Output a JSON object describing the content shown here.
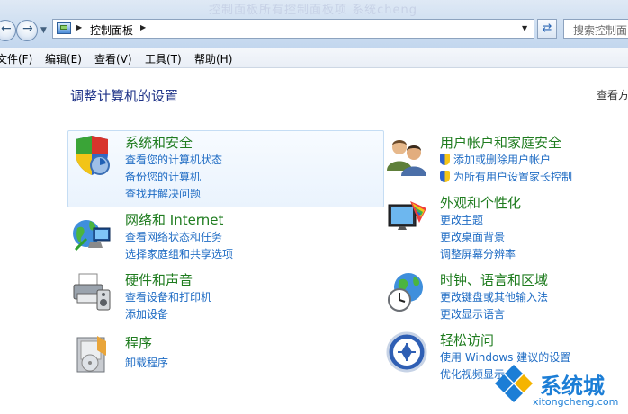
{
  "header": {
    "breadcrumb": "控制面板",
    "search_placeholder": "搜索控制面",
    "watermark": "控制面板所有控制面板项 系统cheng"
  },
  "menu": [
    "文件(F)",
    "编辑(E)",
    "查看(V)",
    "工具(T)",
    "帮助(H)"
  ],
  "main": {
    "title": "调整计算机的设置",
    "view_by": "查看方"
  },
  "categories": {
    "system_security": {
      "title": "系统和安全",
      "links": [
        "查看您的计算机状态",
        "备份您的计算机",
        "查找并解决问题"
      ]
    },
    "network": {
      "title": "网络和 Internet",
      "links": [
        "查看网络状态和任务",
        "选择家庭组和共享选项"
      ]
    },
    "hardware": {
      "title": "硬件和声音",
      "links": [
        "查看设备和打印机",
        "添加设备"
      ]
    },
    "programs": {
      "title": "程序",
      "links": [
        "卸载程序"
      ]
    },
    "user_accounts": {
      "title": "用户帐户和家庭安全",
      "links": [
        "添加或删除用户帐户",
        "为所有用户设置家长控制"
      ]
    },
    "appearance": {
      "title": "外观和个性化",
      "links": [
        "更改主题",
        "更改桌面背景",
        "调整屏幕分辨率"
      ]
    },
    "clock_region": {
      "title": "时钟、语言和区域",
      "links": [
        "更改键盘或其他输入法",
        "更改显示语言"
      ]
    },
    "ease_access": {
      "title": "轻松访问",
      "links": [
        "使用 Windows 建议的设置",
        "优化视频显示"
      ]
    }
  },
  "logo": {
    "name": "系统城",
    "url": "xitongcheng.com"
  },
  "colors": {
    "link": "#1f6cc4",
    "category_title": "#1f7c1f",
    "page_title": "#1e3287",
    "brand": "#1c7ed6"
  }
}
